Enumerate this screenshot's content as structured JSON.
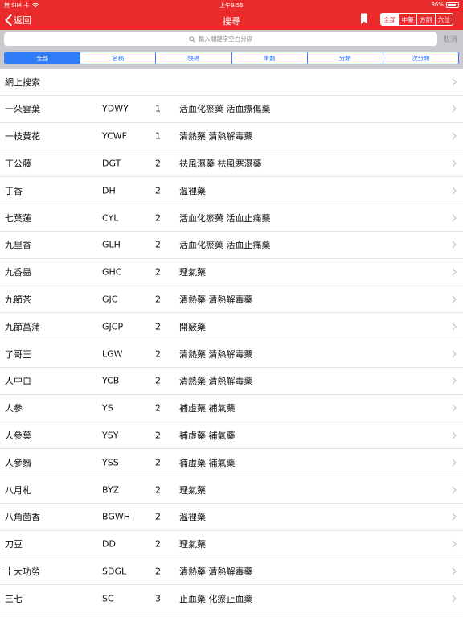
{
  "status_bar": {
    "carrier": "無 SIM 卡",
    "time": "上午9:55",
    "battery": "86%",
    "battery_level": 0.86
  },
  "nav": {
    "back_label": "返回",
    "title": "搜尋",
    "scope_tabs": [
      "全部",
      "中藥",
      "方劑",
      "穴位"
    ],
    "scope_selected": 0
  },
  "search": {
    "placeholder": "輸入關鍵字空白分隔",
    "cancel_label": "取消"
  },
  "filter_tabs": [
    "全部",
    "名稱",
    "快碼",
    "筆劃",
    "分類",
    "次分類"
  ],
  "filter_selected": 0,
  "web_search_label": "網上搜索",
  "rows": [
    {
      "name": "一朵雲葉",
      "code": "YDWY",
      "strokes": "1",
      "category": "活血化瘀藥 活血療傷藥"
    },
    {
      "name": "一枝黃花",
      "code": "YCWF",
      "strokes": "1",
      "category": "清熱藥 清熱解毒藥"
    },
    {
      "name": "丁公藤",
      "code": "DGT",
      "strokes": "2",
      "category": "祛風濕藥 祛風寒濕藥"
    },
    {
      "name": "丁香",
      "code": "DH",
      "strokes": "2",
      "category": "溫裡藥"
    },
    {
      "name": "七葉蓮",
      "code": "CYL",
      "strokes": "2",
      "category": "活血化瘀藥 活血止痛藥"
    },
    {
      "name": "九里香",
      "code": "GLH",
      "strokes": "2",
      "category": "活血化瘀藥 活血止痛藥"
    },
    {
      "name": "九香蟲",
      "code": "GHC",
      "strokes": "2",
      "category": "理氣藥"
    },
    {
      "name": "九節茶",
      "code": "GJC",
      "strokes": "2",
      "category": "清熱藥 清熱解毒藥"
    },
    {
      "name": "九節菖蒲",
      "code": "GJCP",
      "strokes": "2",
      "category": "開竅藥"
    },
    {
      "name": "了哥王",
      "code": "LGW",
      "strokes": "2",
      "category": "清熱藥 清熱解毒藥"
    },
    {
      "name": "人中白",
      "code": "YCB",
      "strokes": "2",
      "category": "清熱藥 清熱解毒藥"
    },
    {
      "name": "人參",
      "code": "YS",
      "strokes": "2",
      "category": "補虛藥 補氣藥"
    },
    {
      "name": "人參葉",
      "code": "YSY",
      "strokes": "2",
      "category": "補虛藥 補氣藥"
    },
    {
      "name": "人參鬚",
      "code": "YSS",
      "strokes": "2",
      "category": "補虛藥 補氣藥"
    },
    {
      "name": "八月札",
      "code": "BYZ",
      "strokes": "2",
      "category": "理氣藥"
    },
    {
      "name": "八角茴香",
      "code": "BGWH",
      "strokes": "2",
      "category": "溫裡藥"
    },
    {
      "name": "刀豆",
      "code": "DD",
      "strokes": "2",
      "category": "理氣藥"
    },
    {
      "name": "十大功勞",
      "code": "SDGL",
      "strokes": "2",
      "category": "清熱藥 清熱解毒藥"
    },
    {
      "name": "三七",
      "code": "SC",
      "strokes": "3",
      "category": "止血藥 化瘀止血藥"
    }
  ],
  "colors": {
    "nav_red": "#ea2b2c",
    "accent_blue": "#2f7cf6",
    "search_bg": "#c9c9ce"
  },
  "icons": [
    "back-chevron-icon",
    "bookmark-icon",
    "search-icon",
    "chevron-right-icon",
    "wifi-icon",
    "battery-icon"
  ]
}
